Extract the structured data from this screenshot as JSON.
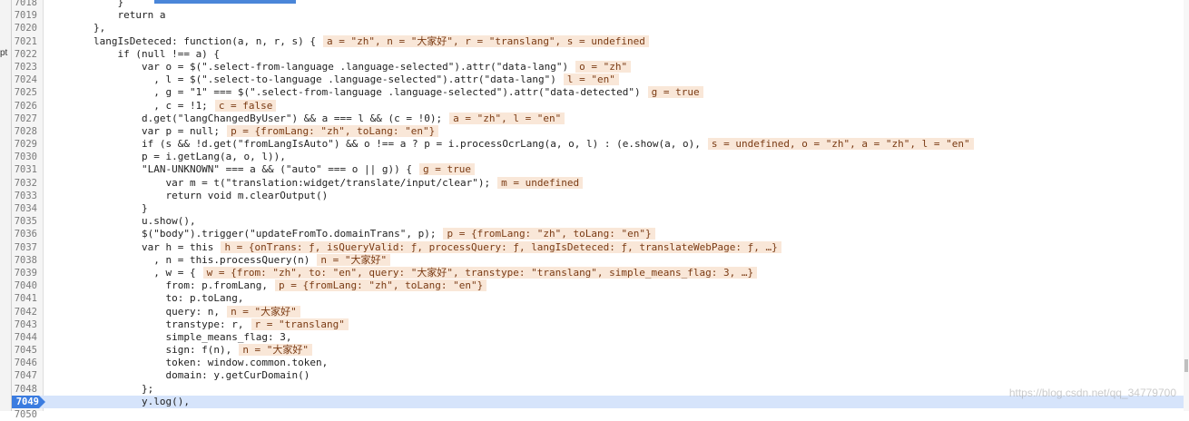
{
  "left_pane_fragment": "pt",
  "watermark": "https://blog.csdn.net/qq_34779700",
  "lines": [
    {
      "n": "7018",
      "code": "            }"
    },
    {
      "n": "7019",
      "code": "            return a",
      "kw": "return"
    },
    {
      "n": "7020",
      "code": "        },"
    },
    {
      "n": "7021",
      "code": "        langIsDeteced: function(a, n, r, s) {",
      "inline": "a = \"zh\", n = \"大家好\", r = \"translang\", s = undefined"
    },
    {
      "n": "7022",
      "code": "            if (null !== a) {"
    },
    {
      "n": "7023",
      "code": "                var o = $(\".select-from-language .language-selected\").attr(\"data-lang\")",
      "inline": "o = \"zh\""
    },
    {
      "n": "7024",
      "code": "                  , l = $(\".select-to-language .language-selected\").attr(\"data-lang\")",
      "inline": "l = \"en\""
    },
    {
      "n": "7025",
      "code": "                  , g = \"1\" === $(\".select-from-language .language-selected\").attr(\"data-detected\")",
      "inline": "g = true"
    },
    {
      "n": "7026",
      "code": "                  , c = !1;",
      "inline": "c = false"
    },
    {
      "n": "7027",
      "code": "                d.get(\"langChangedByUser\") && a === l && (c = !0);",
      "inline": "a = \"zh\", l = \"en\""
    },
    {
      "n": "7028",
      "code": "                var p = null;",
      "inline": "p = {fromLang: \"zh\", toLang: \"en\"}"
    },
    {
      "n": "7029",
      "code": "                if (s && !d.get(\"fromLangIsAuto\") && o !== a ? p = i.processOcrLang(a, o, l) : (e.show(a, o),",
      "inline": "s = undefined, o = \"zh\", a = \"zh\", l = \"en\""
    },
    {
      "n": "7030",
      "code": "                p = i.getLang(a, o, l)),"
    },
    {
      "n": "7031",
      "code": "                \"LAN-UNKNOWN\" === a && (\"auto\" === o || g)) {",
      "inline": "g = true"
    },
    {
      "n": "7032",
      "code": "                    var m = t(\"translation:widget/translate/input/clear\");",
      "inline": "m = undefined"
    },
    {
      "n": "7033",
      "code": "                    return void m.clearOutput()"
    },
    {
      "n": "7034",
      "code": "                }"
    },
    {
      "n": "7035",
      "code": "                u.show(),"
    },
    {
      "n": "7036",
      "code": "                $(\"body\").trigger(\"updateFromTo.domainTrans\", p);",
      "inline": "p = {fromLang: \"zh\", toLang: \"en\"}"
    },
    {
      "n": "7037",
      "code": "                var h = this",
      "inline": "h = {onTrans: ƒ, isQueryValid: ƒ, processQuery: ƒ, langIsDeteced: ƒ, translateWebPage: ƒ, …}"
    },
    {
      "n": "7038",
      "code": "                  , n = this.processQuery(n)",
      "inline": "n = \"大家好\""
    },
    {
      "n": "7039",
      "code": "                  , w = {",
      "inline": "w = {from: \"zh\", to: \"en\", query: \"大家好\", transtype: \"translang\", simple_means_flag: 3, …}"
    },
    {
      "n": "7040",
      "code": "                    from: p.fromLang,",
      "inline": "p = {fromLang: \"zh\", toLang: \"en\"}"
    },
    {
      "n": "7041",
      "code": "                    to: p.toLang,"
    },
    {
      "n": "7042",
      "code": "                    query: n,",
      "inline": "n = \"大家好\""
    },
    {
      "n": "7043",
      "code": "                    transtype: r,",
      "inline": "r = \"translang\""
    },
    {
      "n": "7044",
      "code": "                    simple_means_flag: 3,"
    },
    {
      "n": "7045",
      "code": "                    sign: f(n),",
      "inline": "n = \"大家好\""
    },
    {
      "n": "7046",
      "code": "                    token: window.common.token,"
    },
    {
      "n": "7047",
      "code": "                    domain: y.getCurDomain()"
    },
    {
      "n": "7048",
      "code": "                };"
    },
    {
      "n": "7049",
      "code": "                y.log(),",
      "exec": true
    },
    {
      "n": "7050",
      "code": "                "
    }
  ]
}
